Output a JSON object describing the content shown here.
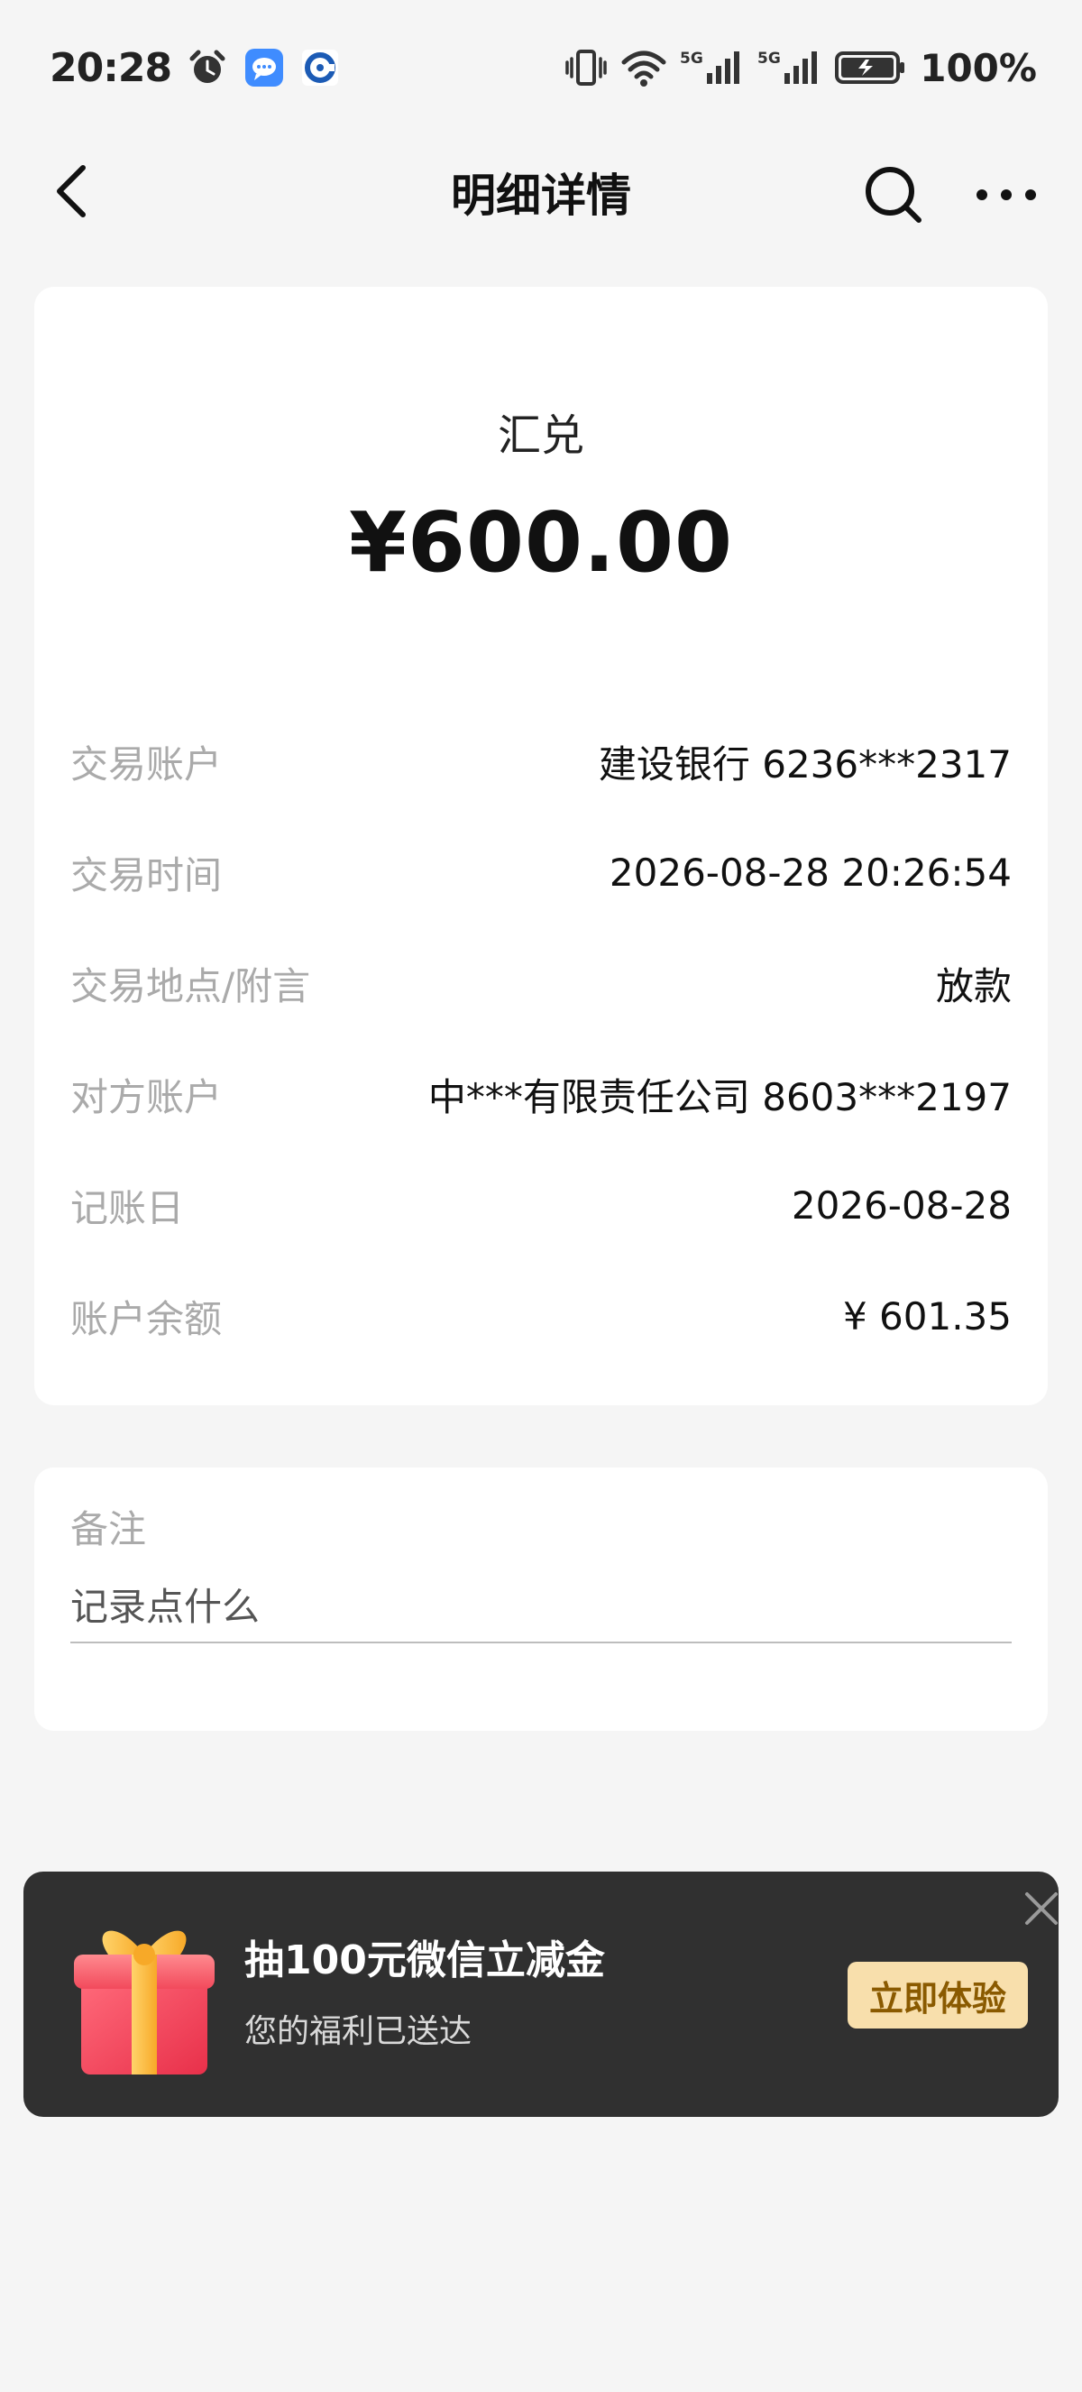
{
  "status_bar": {
    "time": "20:28",
    "battery": "100%",
    "icons": [
      "alarm-icon",
      "message-icon",
      "bank-app-icon",
      "vibrate-icon",
      "wifi-icon",
      "signal-5g-icon",
      "battery-icon"
    ]
  },
  "nav": {
    "title": "明细详情",
    "icons": [
      "back-icon",
      "search-icon",
      "more-icon"
    ]
  },
  "transaction": {
    "type": "汇兑",
    "amount": "¥600.00",
    "rows": [
      {
        "label": "交易账户",
        "value": "建设银行 6236***2317"
      },
      {
        "label": "交易时间",
        "value": "2026-08-28 20:26:54"
      },
      {
        "label": "交易地点/附言",
        "value": "放款"
      },
      {
        "label": "对方账户",
        "value": "中***有限责任公司 8603***2197"
      },
      {
        "label": "记账日",
        "value": "2026-08-28"
      },
      {
        "label": "账户余额",
        "value": "¥ 601.35"
      }
    ]
  },
  "remark": {
    "label": "备注",
    "placeholder": "记录点什么"
  },
  "promo": {
    "title": "抽100元微信立减金",
    "subtitle": "您的福利已送达",
    "button": "立即体验",
    "icons": [
      "gift-icon",
      "close-icon"
    ]
  },
  "colors": {
    "background": "#f5f5f5",
    "label_gray": "#aaaaaa",
    "promo_bg": "#303030",
    "promo_button": "#f8dfac",
    "promo_button_text": "#8a5a00"
  }
}
